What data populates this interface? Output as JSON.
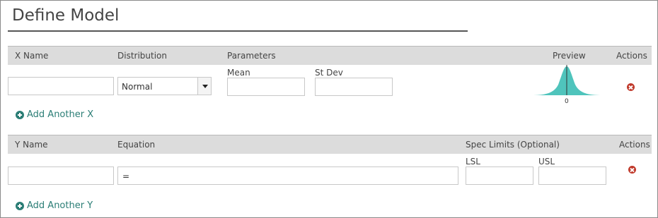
{
  "title": "Define Model",
  "x_section": {
    "headers": {
      "name": "X Name",
      "distribution": "Distribution",
      "parameters": "Parameters",
      "preview": "Preview",
      "actions": "Actions"
    },
    "row": {
      "name_value": "",
      "distribution_value": "Normal",
      "param1_label": "Mean",
      "param1_value": "",
      "param2_label": "St Dev",
      "param2_value": "",
      "preview_tick": "0"
    },
    "add_label": "Add Another X"
  },
  "y_section": {
    "headers": {
      "name": "Y Name",
      "equation": "Equation",
      "spec_limits": "Spec Limits (Optional)",
      "actions": "Actions"
    },
    "row": {
      "name_value": "",
      "equation_value": "=",
      "lsl_label": "LSL",
      "lsl_value": "",
      "usl_label": "USL",
      "usl_value": ""
    },
    "add_label": "Add Another Y"
  },
  "icons": {
    "add": "plus-circle-icon",
    "delete": "close-circle-icon",
    "dropdown": "caret-down-icon"
  },
  "colors": {
    "accent": "#2a7d75",
    "preview_fill": "#4fc4bc",
    "delete": "#c0392b",
    "header_bg": "#dcdcdc"
  }
}
